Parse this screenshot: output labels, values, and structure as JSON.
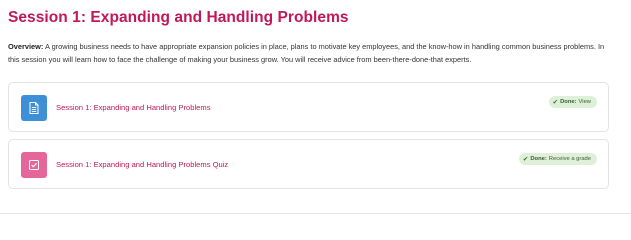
{
  "session": {
    "title": "Session 1: Expanding and Handling Problems",
    "overview_label": "Overview:",
    "overview_text": " A growing business needs to have appropriate expansion policies in place, plans to motivate key employees, and the know-how in handling common business problems. In this session you will learn how to face the challenge of making your business grow. You will receive advice from been-there-done-that experts."
  },
  "activities": [
    {
      "name": "Session 1: Expanding and Handling Problems",
      "icon": "page-icon",
      "icon_color": "#3d8fd6",
      "completion_label": "Done:",
      "completion_text": "View"
    },
    {
      "name": "Session 1: Expanding and Handling Problems Quiz",
      "icon": "quiz-icon",
      "icon_color": "#e5679a",
      "completion_label": "Done:",
      "completion_text": "Receive a grade"
    }
  ],
  "colors": {
    "accent": "#c0185a",
    "done_badge_bg": "#dff0d8"
  }
}
